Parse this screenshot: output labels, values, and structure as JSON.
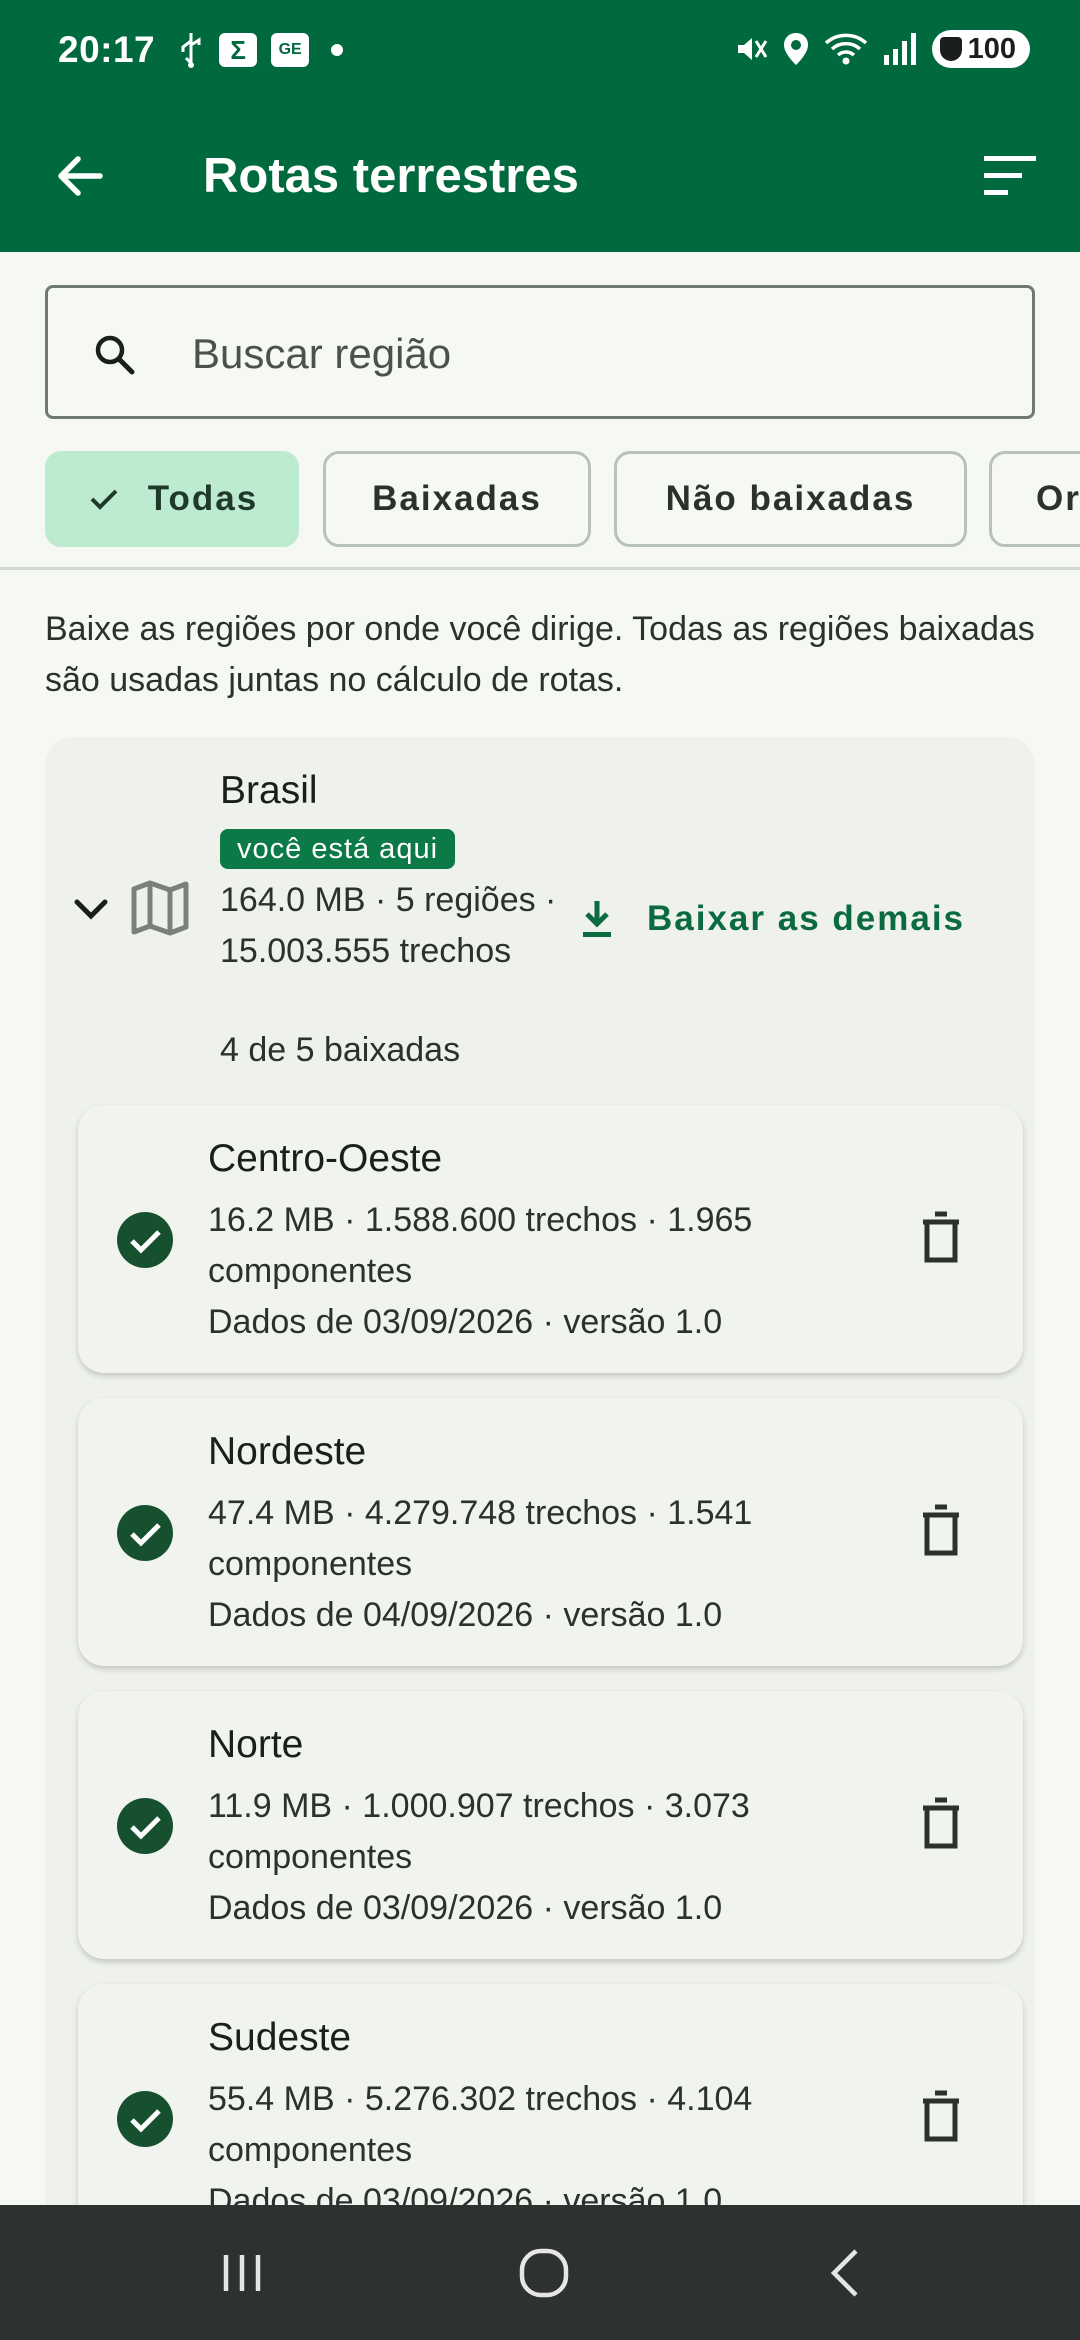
{
  "status_bar": {
    "time": "20:17",
    "icons_left": [
      "usb-icon",
      "sigma-app-icon",
      "ge-app-icon",
      "notification-dot-icon"
    ],
    "icons_right": [
      "vibrate-mute-icon",
      "location-icon",
      "wifi-icon",
      "signal-icon"
    ],
    "battery": "100"
  },
  "app_bar": {
    "title": "Rotas terrestres",
    "back_icon": "arrow-left-icon",
    "sort_icon": "sort-icon"
  },
  "search": {
    "placeholder": "Buscar região",
    "value": ""
  },
  "filters": {
    "chips": [
      {
        "label": "Todas",
        "active": true
      },
      {
        "label": "Baixadas",
        "active": false
      },
      {
        "label": "Não baixadas",
        "active": false
      },
      {
        "label": "Or",
        "active": false
      }
    ]
  },
  "intro_text": "Baixe as regiões por onde você dirige. Todas as regiões baixadas são usadas juntas no cálculo de rotas.",
  "group": {
    "name": "Brasil",
    "badge": "você está aqui",
    "meta": "164.0 MB · 5 regiões · 15.003.555 trechos",
    "count": "4 de 5 baixadas",
    "download_label": "Baixar as demais"
  },
  "regions": [
    {
      "name": "Centro-Oeste",
      "meta": "16.2 MB · 1.588.600 trechos · 1.965 componentes",
      "date": "Dados de 03/09/2026 · versão 1.0"
    },
    {
      "name": "Nordeste",
      "meta": "47.4 MB · 4.279.748 trechos · 1.541 componentes",
      "date": "Dados de 04/09/2026 · versão 1.0"
    },
    {
      "name": "Norte",
      "meta": "11.9 MB · 1.000.907 trechos · 3.073 componentes",
      "date": "Dados de 03/09/2026 · versão 1.0"
    },
    {
      "name": "Sudeste",
      "meta": "55.4 MB · 5.276.302 trechos · 4.104 componentes",
      "date": "Dados de 03/09/2026 · versão 1.0"
    }
  ],
  "colors": {
    "primary": "#006a3e",
    "chip_active": "#bdebd0",
    "badge": "#0b7a47",
    "check": "#17502f",
    "navbar": "#2d3130"
  },
  "nav_bar": [
    "recents-icon",
    "home-icon",
    "back-icon"
  ]
}
